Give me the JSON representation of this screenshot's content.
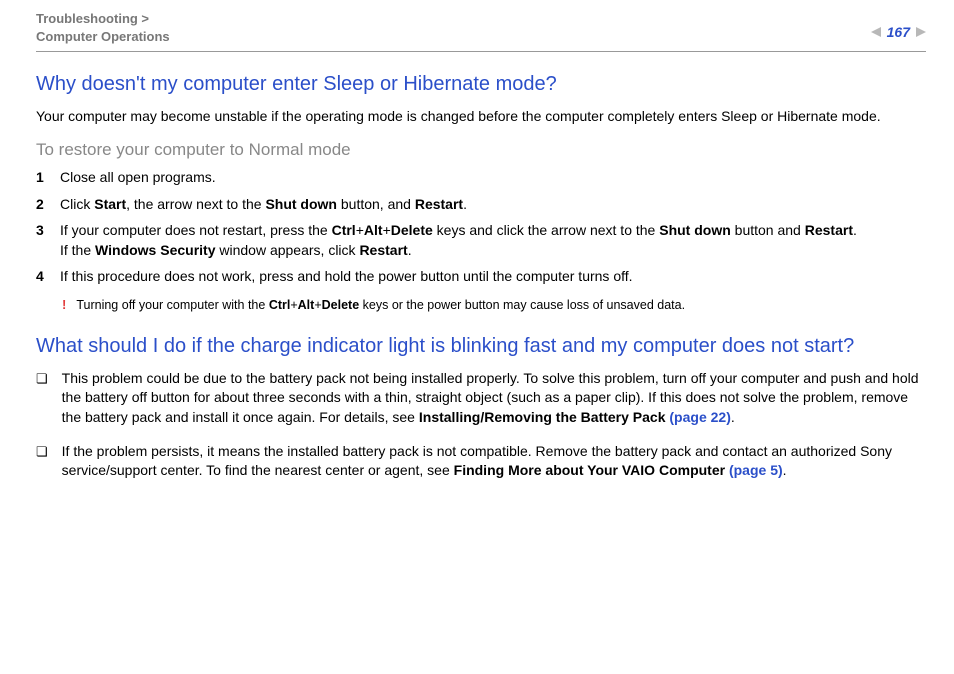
{
  "header": {
    "breadcrumb_line1": "Troubleshooting >",
    "breadcrumb_line2": "Computer Operations",
    "page_number": "167"
  },
  "sections": {
    "sleep": {
      "title": "Why doesn't my computer enter Sleep or Hibernate mode?",
      "intro": "Your computer may become unstable if the operating mode is changed before the computer completely enters Sleep or Hibernate mode.",
      "subhead": "To restore your computer to Normal mode",
      "steps": [
        {
          "n": "1",
          "text_plain": "Close all open programs."
        },
        {
          "n": "2",
          "pre": "Click ",
          "b1": "Start",
          "mid1": ", the arrow next to the ",
          "b2": "Shut down",
          "mid2": " button, and ",
          "b3": "Restart",
          "post": "."
        },
        {
          "n": "3",
          "l1_pre": "If your computer does not restart, press the ",
          "l1_b1": "Ctrl",
          "l1_p1": "+",
          "l1_b2": "Alt",
          "l1_p2": "+",
          "l1_b3": "Delete",
          "l1_mid": " keys and click the arrow next to the ",
          "l1_b4": "Shut down",
          "l1_mid2": " button and ",
          "l1_b5": "Restart",
          "l1_post": ".",
          "l2_pre": "If the ",
          "l2_b1": "Windows Security",
          "l2_mid": " window appears, click ",
          "l2_b2": "Restart",
          "l2_post": "."
        },
        {
          "n": "4",
          "text_plain": "If this procedure does not work, press and hold the power button until the computer turns off."
        }
      ],
      "note": {
        "bang": "!",
        "pre": "Turning off your computer with the ",
        "b1": "Ctrl",
        "p1": "+",
        "b2": "Alt",
        "p2": "+",
        "b3": "Delete",
        "post": " keys or the power button may cause loss of unsaved data."
      }
    },
    "charge": {
      "title": "What should I do if the charge indicator light is blinking fast and my computer does not start?",
      "bullets": [
        {
          "pre": "This problem could be due to the battery pack not being installed properly. To solve this problem, turn off your computer and push and hold the battery off button for about three seconds with a thin, straight object (such as a paper clip). If this does not solve the problem, remove the battery pack and install it once again. For details, see ",
          "bold": "Installing/Removing the Battery Pack ",
          "link": "(page 22)",
          "post": "."
        },
        {
          "pre": "If the problem persists, it means the installed battery pack is not compatible. Remove the battery pack and contact an authorized Sony service/support center. To find the nearest center or agent, see ",
          "bold": "Finding More about Your VAIO Computer ",
          "link": "(page 5)",
          "post": "."
        }
      ]
    }
  }
}
